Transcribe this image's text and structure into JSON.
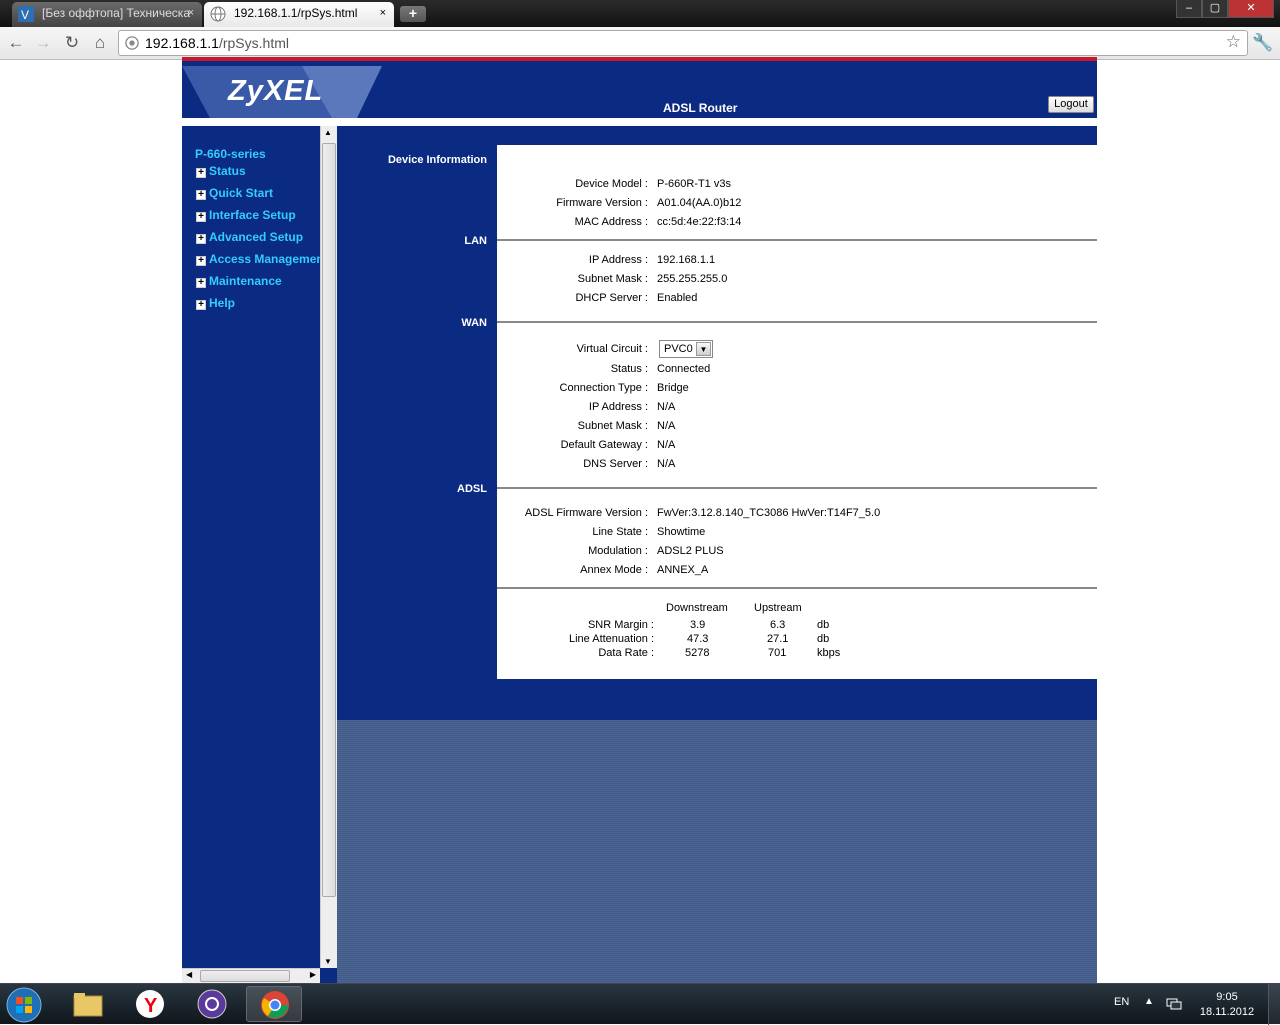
{
  "browser": {
    "tabs": [
      {
        "title": "[Без оффтопа] Техническа",
        "close": "×"
      },
      {
        "title": "192.168.1.1/rpSys.html",
        "close": "×"
      }
    ],
    "new_tab": "+",
    "window_controls": {
      "minimize": "–",
      "maximize": "▢",
      "close": "✕"
    },
    "url_host": "192.168.1.1",
    "url_path": "/rpSys.html"
  },
  "header": {
    "logo": "ZyXEL",
    "title": "ADSL Router",
    "logout_label": "Logout"
  },
  "sidebar": {
    "series": "P-660-series",
    "items": [
      {
        "label": "Status"
      },
      {
        "label": "Quick Start"
      },
      {
        "label": "Interface Setup"
      },
      {
        "label": "Advanced Setup"
      },
      {
        "label": "Access Management"
      },
      {
        "label": "Maintenance"
      },
      {
        "label": "Help"
      }
    ],
    "expander": "+"
  },
  "sections": {
    "device": "Device Information",
    "lan": "LAN",
    "wan": "WAN",
    "adsl": "ADSL"
  },
  "device_info": [
    {
      "key": "Device Model :",
      "value": "P-660R-T1 v3s"
    },
    {
      "key": "Firmware Version :",
      "value": "A01.04(AA.0)b12"
    },
    {
      "key": "MAC Address :",
      "value": "cc:5d:4e:22:f3:14"
    }
  ],
  "lan": [
    {
      "key": "IP Address :",
      "value": "192.168.1.1"
    },
    {
      "key": "Subnet Mask :",
      "value": "255.255.255.0"
    },
    {
      "key": "DHCP Server :",
      "value": "Enabled"
    }
  ],
  "wan": {
    "virtual_circuit_label": "Virtual Circuit :",
    "virtual_circuit_value": "PVC0",
    "rows": [
      {
        "key": "Status :",
        "value": "Connected"
      },
      {
        "key": "Connection Type :",
        "value": "Bridge"
      },
      {
        "key": "IP Address :",
        "value": "N/A"
      },
      {
        "key": "Subnet Mask :",
        "value": "N/A"
      },
      {
        "key": "Default Gateway :",
        "value": "N/A"
      },
      {
        "key": "DNS Server :",
        "value": "N/A"
      }
    ]
  },
  "adsl": [
    {
      "key": "ADSL Firmware Version :",
      "value": "FwVer:3.12.8.140_TC3086 HwVer:T14F7_5.0"
    },
    {
      "key": "Line State :",
      "value": "Showtime"
    },
    {
      "key": "Modulation :",
      "value": "ADSL2 PLUS"
    },
    {
      "key": "Annex Mode :",
      "value": "ANNEX_A"
    }
  ],
  "stats": {
    "headers": {
      "down": "Downstream",
      "up": "Upstream"
    },
    "rows": [
      {
        "key": "SNR Margin :",
        "down": "3.9",
        "up": "6.3",
        "unit": "db"
      },
      {
        "key": "Line Attenuation :",
        "down": "47.3",
        "up": "27.1",
        "unit": "db"
      },
      {
        "key": "Data Rate :",
        "down": "5278",
        "up": "701",
        "unit": "kbps"
      }
    ]
  },
  "taskbar": {
    "lang": "EN",
    "time": "9:05",
    "date": "18.11.2012"
  }
}
